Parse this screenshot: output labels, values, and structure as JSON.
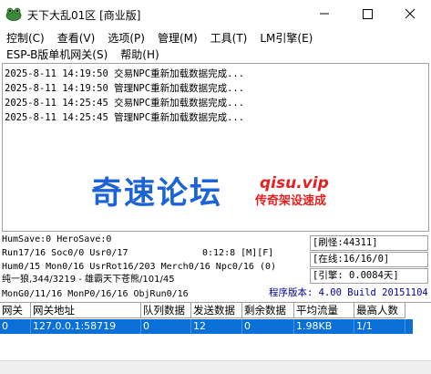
{
  "window": {
    "title": "天下大乱01区 [商业版]",
    "app_icon": "frog-icon",
    "min_icon": "minimize-icon",
    "max_icon": "maximize-icon",
    "close_icon": "close-icon"
  },
  "menu": {
    "row1": [
      "控制(C)",
      "查看(V)",
      "选项(P)",
      "管理(M)",
      "工具(T)",
      "LM引擎(E)"
    ],
    "row2": [
      "ESP-B版单机网关(S)",
      "帮助(H)"
    ]
  },
  "log": [
    "2025-8-11 14:19:50 交易NPC重新加载数据完成...",
    "2025-8-11 14:19:50 管理NPC重新加载数据完成...",
    "2025-8-11 14:25:45 交易NPC重新加载数据完成...",
    "2025-8-11 14:25:45 管理NPC重新加载数据完成..."
  ],
  "watermark": {
    "main": "奇速论坛",
    "url": "qisu.vip",
    "sub": "传奇架设速成"
  },
  "status": {
    "line1": "HumSave:0 HeroSave:0",
    "line2": "Run17/16 Soc0/0 Usr0/17",
    "timer": "0:12:8 [M][F]",
    "line3": "Hum0/15 Mon0/16 UsrRot16/203 Merch0/16 Npc0/16 (0)",
    "line4": "纯一狼,344/3219 - 雄霸天下苍熊/101/45",
    "line5": "MonG0/11/16 MonP0/16/16 ObjRun0/16",
    "refresh": "[刷怪:44311]",
    "online": "[在线:16/16/0]",
    "engine": "[引擎: 0.0084天]",
    "version": "程序版本: 4.00 Build 20151104"
  },
  "table": {
    "headers": [
      "网关",
      "网关地址",
      "队列数据",
      "发送数据",
      "剩余数据",
      "平均流量",
      "最高人数"
    ],
    "rows": [
      [
        "0",
        "127.0.0.1:58719",
        "0",
        "12",
        "0",
        "1.98KB",
        "1/1"
      ]
    ]
  },
  "colors": {
    "selection": "#0a6fd6",
    "watermark_blue": "#1c63d8",
    "watermark_red": "#e52020",
    "version_text": "#0000a0"
  }
}
